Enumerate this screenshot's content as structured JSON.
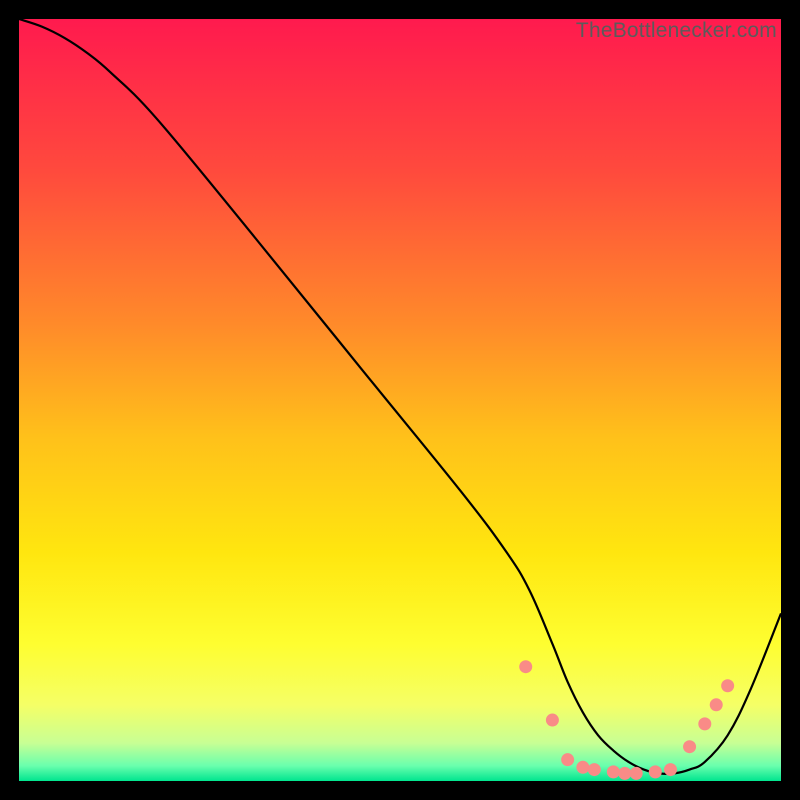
{
  "watermark": "TheBottlenecker.com",
  "chart_data": {
    "type": "line",
    "title": "",
    "xlabel": "",
    "ylabel": "",
    "xlim": [
      0,
      100
    ],
    "ylim": [
      0,
      100
    ],
    "background_gradient": {
      "stops": [
        {
          "y": 100,
          "color": "#ff1a4e"
        },
        {
          "y": 80,
          "color": "#ff4a3d"
        },
        {
          "y": 60,
          "color": "#ff8a2a"
        },
        {
          "y": 45,
          "color": "#ffc11a"
        },
        {
          "y": 30,
          "color": "#ffe60f"
        },
        {
          "y": 18,
          "color": "#fefe30"
        },
        {
          "y": 10,
          "color": "#f5ff66"
        },
        {
          "y": 5,
          "color": "#c8ff94"
        },
        {
          "y": 2,
          "color": "#6affad"
        },
        {
          "y": 0,
          "color": "#00e58f"
        }
      ]
    },
    "series": [
      {
        "name": "bottleneck-curve",
        "color": "#000000",
        "x": [
          0,
          3,
          6,
          9,
          12,
          18,
          30,
          45,
          58,
          64,
          67,
          70,
          72,
          74,
          76,
          78,
          80,
          82,
          84,
          86,
          88,
          90,
          93,
          96,
          100
        ],
        "y": [
          100,
          99,
          97.5,
          95.5,
          93,
          87,
          72.5,
          54,
          38,
          30,
          25,
          18,
          13,
          9,
          6,
          4,
          2.5,
          1.5,
          1,
          1,
          1.5,
          2.5,
          6,
          12,
          22
        ]
      }
    ],
    "markers": {
      "name": "highlight-dots",
      "color": "#f98b87",
      "radius": 6.5,
      "points": [
        {
          "x": 66.5,
          "y": 15.0
        },
        {
          "x": 70.0,
          "y": 8.0
        },
        {
          "x": 72.0,
          "y": 2.8
        },
        {
          "x": 74.0,
          "y": 1.8
        },
        {
          "x": 75.5,
          "y": 1.5
        },
        {
          "x": 78.0,
          "y": 1.2
        },
        {
          "x": 79.5,
          "y": 1.0
        },
        {
          "x": 81.0,
          "y": 1.0
        },
        {
          "x": 83.5,
          "y": 1.2
        },
        {
          "x": 85.5,
          "y": 1.5
        },
        {
          "x": 88.0,
          "y": 4.5
        },
        {
          "x": 90.0,
          "y": 7.5
        },
        {
          "x": 91.5,
          "y": 10.0
        },
        {
          "x": 93.0,
          "y": 12.5
        }
      ]
    }
  }
}
